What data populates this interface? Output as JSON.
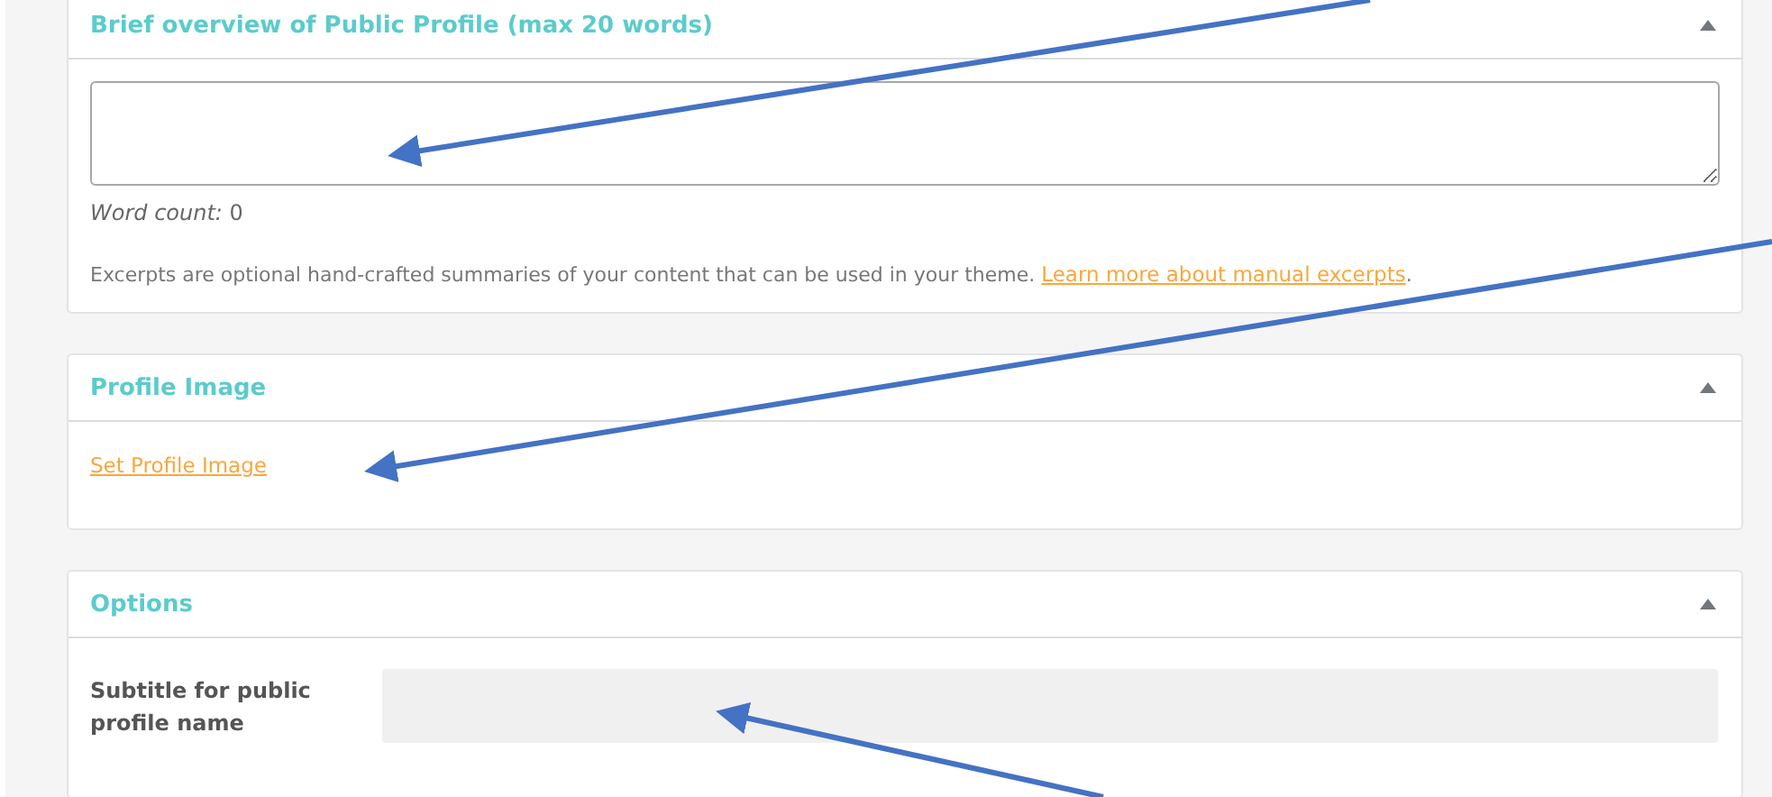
{
  "panels": [
    {
      "kind": "excerpt",
      "title": "Brief overview of Public Profile (max 20 words)",
      "expanded": true,
      "word_count": "*Word count:* 0",
      "description": "Excerpts are optional hand-crafted summaries of your content that can be used in your theme.",
      "link": "Learn more about manual excerpts",
      "after_link": "."
    },
    {
      "kind": "image",
      "title": "Profile Image",
      "expanded": true,
      "link": "Set Profile Image"
    },
    {
      "kind": "options",
      "title": "Options",
      "expanded": true,
      "field_label": "Subtitle for public profile name"
    }
  ]
}
